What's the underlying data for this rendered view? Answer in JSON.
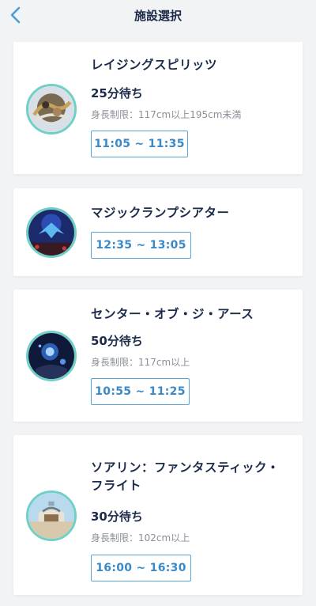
{
  "header": {
    "title": "施設選択",
    "accent_color": "#4a9fd6"
  },
  "cards": [
    {
      "name": "レイジングスピリッツ",
      "wait": "25分待ち",
      "restriction": "身長制限：117cm以上195cm未満",
      "time": "11:05 ~ 11:35"
    },
    {
      "name": "マジックランプシアター",
      "time": "12:35 ~ 13:05"
    },
    {
      "name": "センター・オブ・ジ・アース",
      "wait": "50分待ち",
      "restriction": "身長制限：117cm以上",
      "time": "10:55 ~ 11:25"
    },
    {
      "name_line1": "ソアリン：ファンタスティック・",
      "name_line2": "フライト",
      "wait": "30分待ち",
      "restriction": "身長制限：102cm以上",
      "time": "16:00 ~ 16:30"
    }
  ],
  "colors": {
    "avatar_ring": "#6fd0c6",
    "time_button_border": "#5aa5d8",
    "time_button_text": "#3a89c6",
    "background": "#f2f3f5"
  }
}
